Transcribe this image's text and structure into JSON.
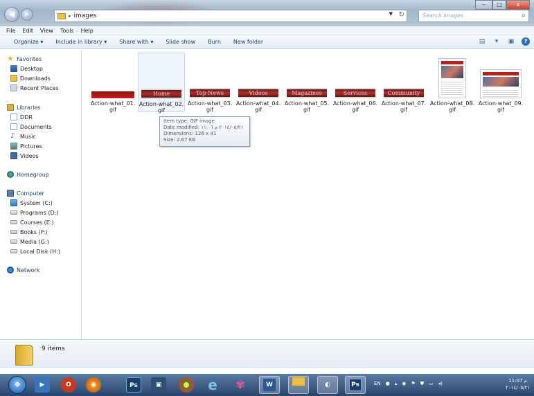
{
  "window": {
    "address": {
      "path": "images"
    },
    "search_placeholder": "Search images",
    "controls": {
      "minimize": "–",
      "maximize": "□",
      "close": "x"
    }
  },
  "menu": [
    "File",
    "Edit",
    "View",
    "Tools",
    "Help"
  ],
  "toolbar": {
    "organize": "Organize ▾",
    "include_in_library": "Include in library ▾",
    "share_with": "Share with ▾",
    "slide_show": "Slide show",
    "burn": "Burn",
    "new_folder": "New folder"
  },
  "sidebar": {
    "favorites": {
      "title": "Favorites",
      "items": [
        "Desktop",
        "Downloads",
        "Recent Places"
      ]
    },
    "libraries": {
      "title": "Libraries",
      "items": [
        "DDR",
        "Documents",
        "Music",
        "Pictures",
        "Videos"
      ]
    },
    "homegroup": "Homegroup",
    "computer": {
      "title": "Computer",
      "items": [
        "System (C:)",
        "Programs (D:)",
        "Courses (E:)",
        "Books (F:)",
        "Media (G:)",
        "Local Disk (H:)"
      ]
    },
    "network": "Network"
  },
  "files": [
    {
      "name": "Action-what_01.gif",
      "banner": ""
    },
    {
      "name": "Action-what_02.gif",
      "banner": "Home"
    },
    {
      "name": "Action-what_03.gif",
      "banner": "Top News"
    },
    {
      "name": "Action-what_04.gif",
      "banner": "Videos"
    },
    {
      "name": "Action-what_05.gif",
      "banner": "Magazines"
    },
    {
      "name": "Action-what_06.gif",
      "banner": "Services"
    },
    {
      "name": "Action-what_07.gif",
      "banner": "Community"
    },
    {
      "name": "Action-what_08.gif",
      "banner": ""
    },
    {
      "name": "Action-what_09.gif",
      "banner": ""
    }
  ],
  "tooltip": {
    "item_type": "Item type: GIF image",
    "date_modified": "Date modified: ٢٠١٤/٠٥/٢١ م ١١:٠٦",
    "dimensions": "Dimensions: 126 x 41",
    "size": "Size: 2.67 KB"
  },
  "status": {
    "item_count": "9 items"
  },
  "taskbar": {
    "language": "EN",
    "time": "11:07 م",
    "date": "٢٠١٤/٠٥/٢١"
  }
}
